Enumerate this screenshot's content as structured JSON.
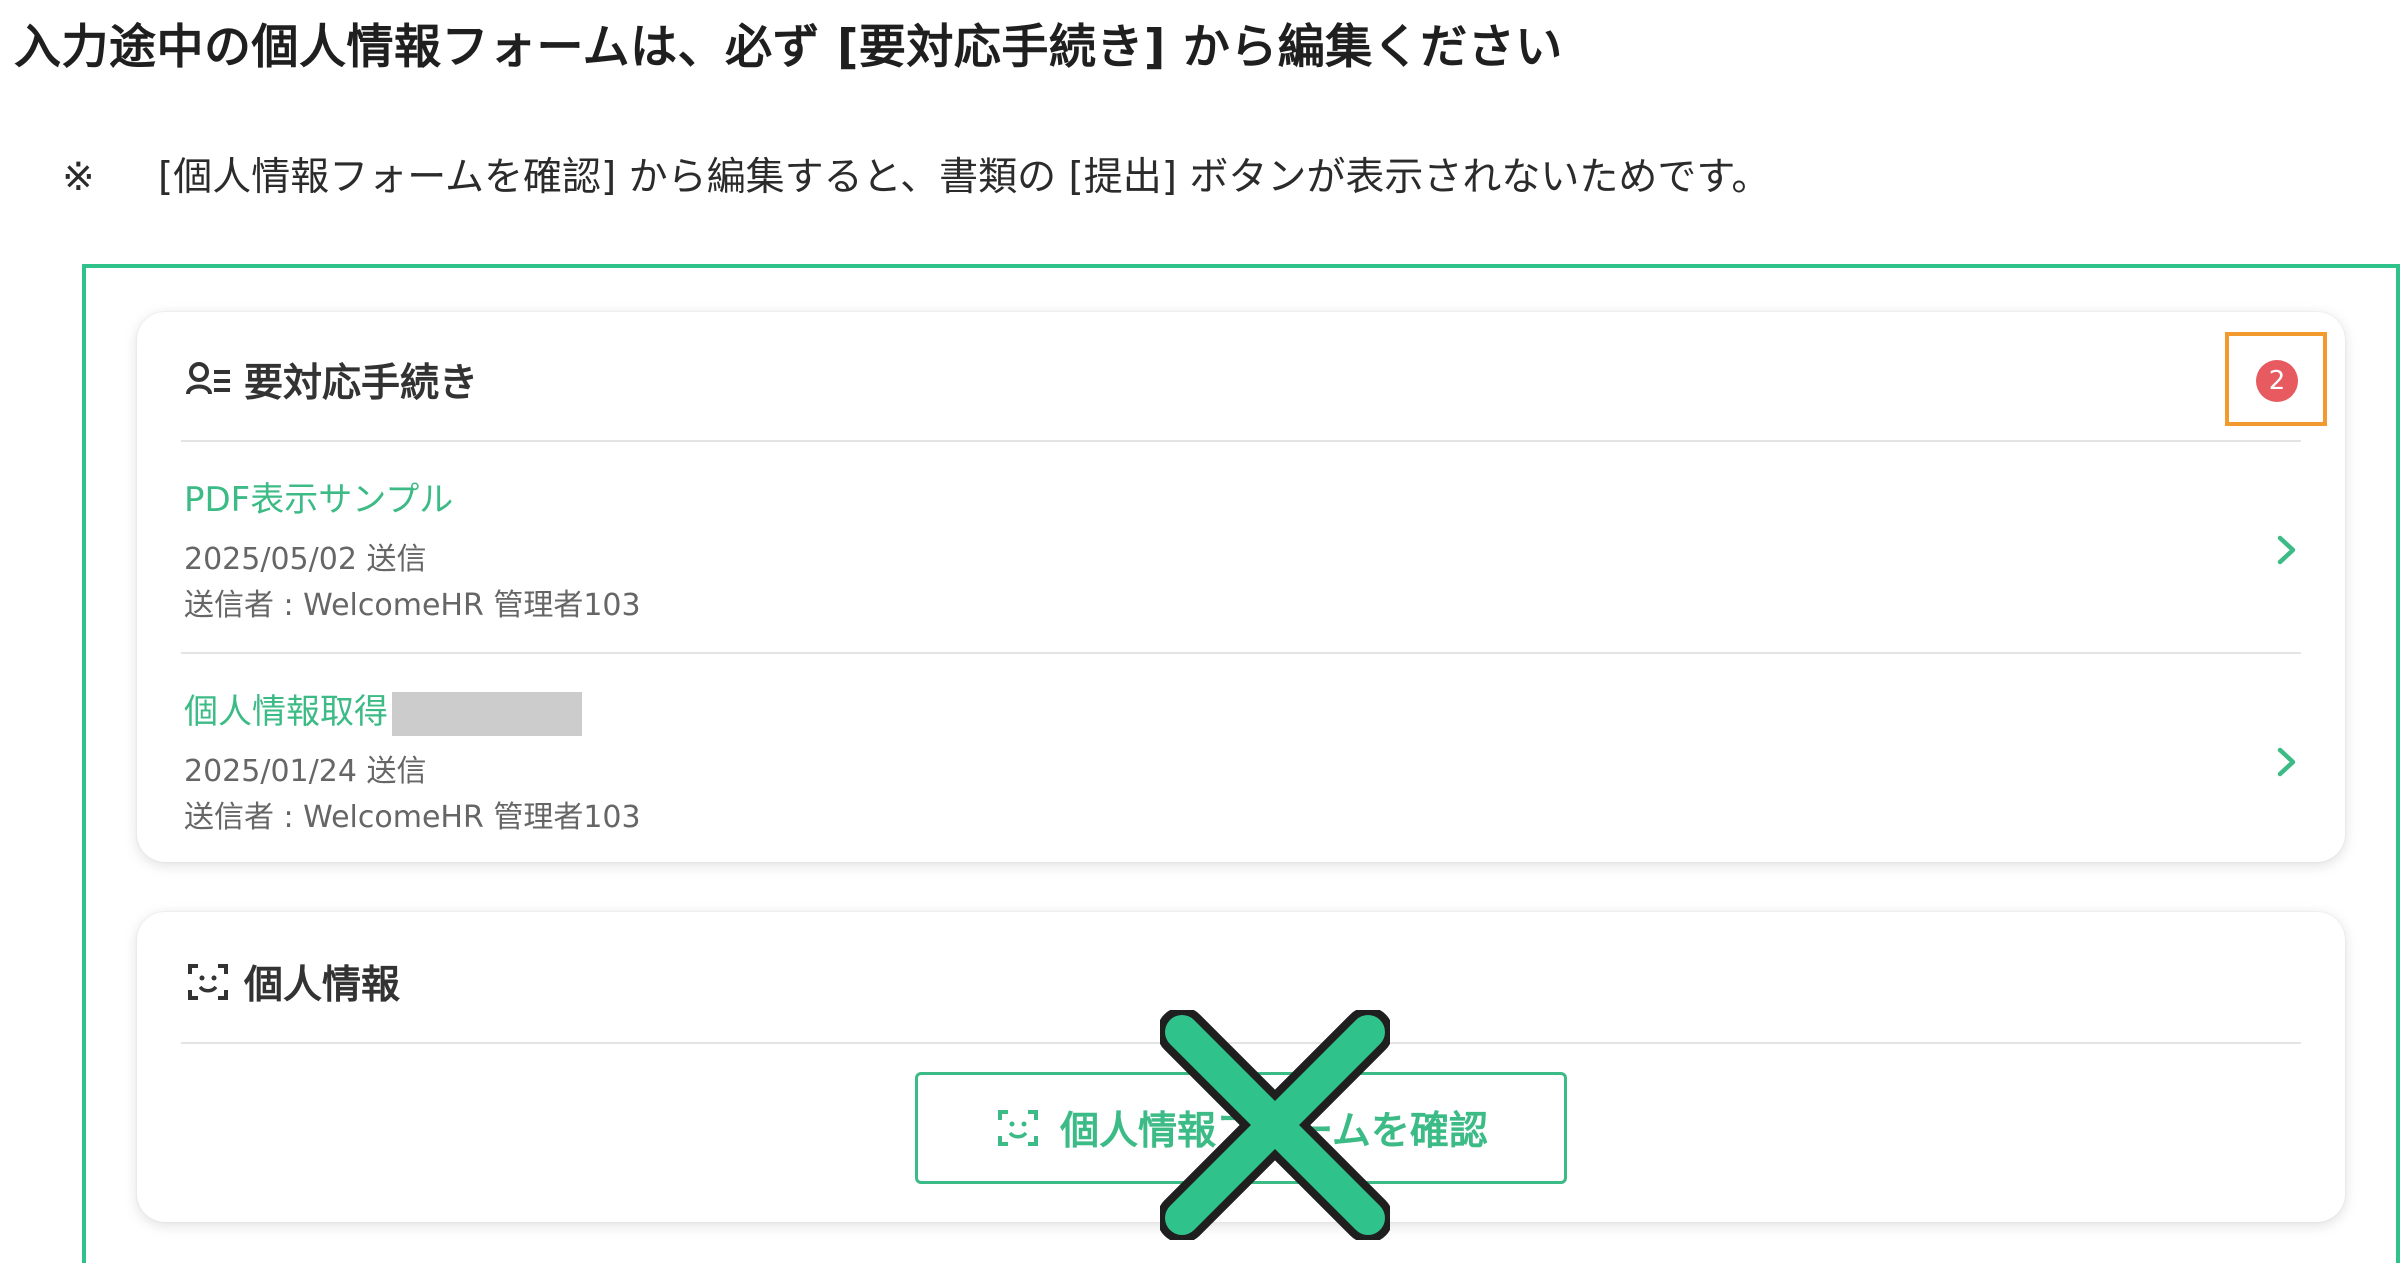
{
  "heading": "入力途中の個人情報フォームは、必ず [要対応手続き] から編集ください",
  "note": {
    "mark": "※",
    "text": "[個人情報フォームを確認] から編集すると、書類の [提出] ボタンが表示されないためです。"
  },
  "procedures_card": {
    "title": "要対応手続き",
    "title_icon": "user-list-icon",
    "badge_count": "2",
    "items": [
      {
        "name": "PDF表示サンプル",
        "redacted": false,
        "date": "2025/05/02 送信",
        "sender": "送信者 : WelcomeHR 管理者103"
      },
      {
        "name": "個人情報取得",
        "redacted": true,
        "date": "2025/01/24 送信",
        "sender": "送信者 : WelcomeHR 管理者103"
      }
    ]
  },
  "personal_card": {
    "title": "個人情報",
    "title_icon": "face-scan-icon",
    "button_label": "個人情報フォームを確認"
  },
  "colors": {
    "accent_green": "#3cbb86",
    "frame_green": "#2fc38b",
    "highlight_orange": "#f29a2e",
    "badge_red": "#e65a60"
  }
}
